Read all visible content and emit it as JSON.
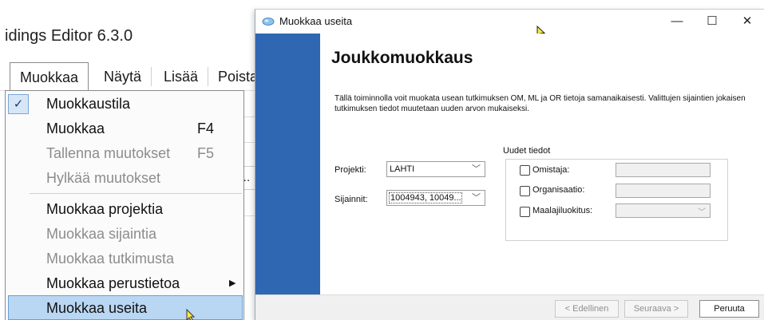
{
  "background_app": {
    "title_fragment": "idings Editor 6.3.0",
    "menubar": [
      "Muokkaa",
      "Näytä",
      "Lisää",
      "Poista"
    ],
    "edge_glyph": "..."
  },
  "edit_menu": {
    "items": [
      {
        "label": "Muokkaustila",
        "checked": true,
        "enabled": true
      },
      {
        "label": "Muokkaa",
        "shortcut": "F4",
        "enabled": true
      },
      {
        "label": "Tallenna muutokset",
        "shortcut": "F5",
        "enabled": false
      },
      {
        "label": "Hylkää muutokset",
        "enabled": false
      },
      {
        "label": "Muokkaa projektia",
        "enabled": true
      },
      {
        "label": "Muokkaa sijaintia",
        "enabled": false
      },
      {
        "label": "Muokkaa tutkimusta",
        "enabled": false
      },
      {
        "label": "Muokkaa perustietoa",
        "enabled": true,
        "submenu": true
      },
      {
        "label": "Muokkaa useita",
        "enabled": true,
        "highlighted": true
      }
    ],
    "check_glyph": "✓",
    "submenu_glyph": "▶"
  },
  "dialog": {
    "title": "Muokkaa useita",
    "controls": {
      "minimize": "—",
      "maximize": "☐",
      "close": "✕"
    },
    "heading": "Joukkomuokkaus",
    "description": "Tällä toiminnolla voit muokata usean tutkimuksen OM, ML ja OR tietoja samanaikaisesti. Valittujen sijaintien jokaisen tutkimuksen tiedot muutetaan uuden arvon mukaiseksi.",
    "project": {
      "label": "Projekti:",
      "value": "LAHTI"
    },
    "locations": {
      "label": "Sijainnit:",
      "value": "1004943, 10049..."
    },
    "new_data": {
      "title": "Uudet tiedot",
      "fields": [
        {
          "label": "Omistaja:",
          "checked": false,
          "type": "text",
          "value": ""
        },
        {
          "label": "Organisaatio:",
          "checked": false,
          "type": "text",
          "value": ""
        },
        {
          "label": "Maalajiluokitus:",
          "checked": false,
          "type": "dropdown",
          "value": ""
        }
      ]
    },
    "buttons": {
      "back": "< Edellinen",
      "next": "Seuraava >",
      "cancel": "Peruuta"
    },
    "colors": {
      "side_panel": "#2f67b3",
      "menu_highlight": "#b9d6f3"
    }
  }
}
